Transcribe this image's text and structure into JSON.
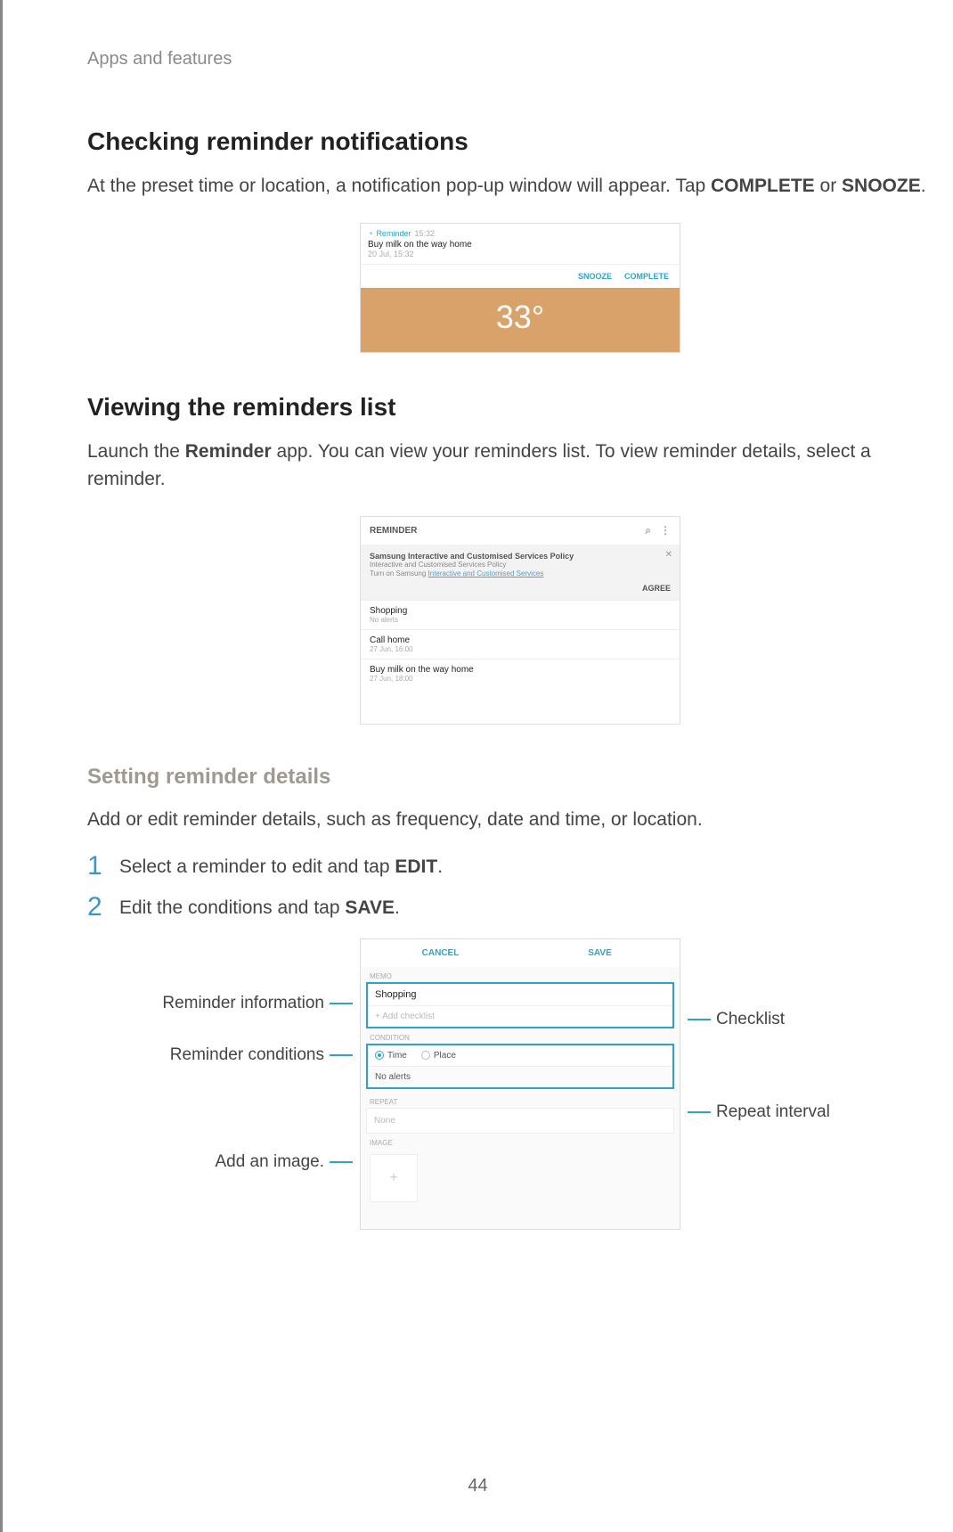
{
  "breadcrumb": "Apps and features",
  "page_number": "44",
  "section1": {
    "heading": "Checking reminder notifications",
    "body_pre": "At the preset time or location, a notification pop-up window will appear. Tap ",
    "bold1": "COMPLETE",
    "body_mid": " or ",
    "bold2": "SNOOZE",
    "body_post": "."
  },
  "shot1": {
    "app_label": "Reminder",
    "time_label": "15:32",
    "title": "Buy milk on the way home",
    "subtitle": "20 Jul, 15:32",
    "snooze": "SNOOZE",
    "complete": "COMPLETE",
    "weather": "33°"
  },
  "section2": {
    "heading": "Viewing the reminders list",
    "body_pre": "Launch the ",
    "bold": "Reminder",
    "body_post": " app. You can view your reminders list. To view reminder details, select a reminder."
  },
  "shot2": {
    "title": "REMINDER",
    "policy_title": "Samsung Interactive and Customised Services Policy",
    "policy_desc1": "Interactive and Customised Services Policy",
    "policy_desc2_pre": "Turn on Samsung ",
    "policy_desc2_link": "Interactive and Customised Services",
    "agree": "AGREE",
    "items": [
      {
        "title": "Shopping",
        "sub": "No alerts"
      },
      {
        "title": "Call home",
        "sub": "27 Jun, 16:00"
      },
      {
        "title": "Buy milk on the way home",
        "sub": "27 Jun, 18:00"
      }
    ]
  },
  "section3": {
    "subheading": "Setting reminder details",
    "body": "Add or edit reminder details, such as frequency, date and time, or location.",
    "step1_pre": "Select a reminder to edit and tap ",
    "step1_bold": "EDIT",
    "step1_post": ".",
    "step2_pre": "Edit the conditions and tap ",
    "step2_bold": "SAVE",
    "step2_post": "."
  },
  "shot3": {
    "cancel": "CANCEL",
    "save": "SAVE",
    "memo_label": "MEMO",
    "memo_value": "Shopping",
    "add_checklist": "+  Add checklist",
    "condition_label": "CONDITION",
    "time": "Time",
    "place": "Place",
    "no_alerts": "No alerts",
    "repeat_label": "REPEAT",
    "repeat_value": "None",
    "image_label": "IMAGE"
  },
  "callouts": {
    "reminder_info": "Reminder information",
    "reminder_cond": "Reminder conditions",
    "add_image": "Add an image.",
    "checklist": "Checklist",
    "repeat": "Repeat interval"
  }
}
